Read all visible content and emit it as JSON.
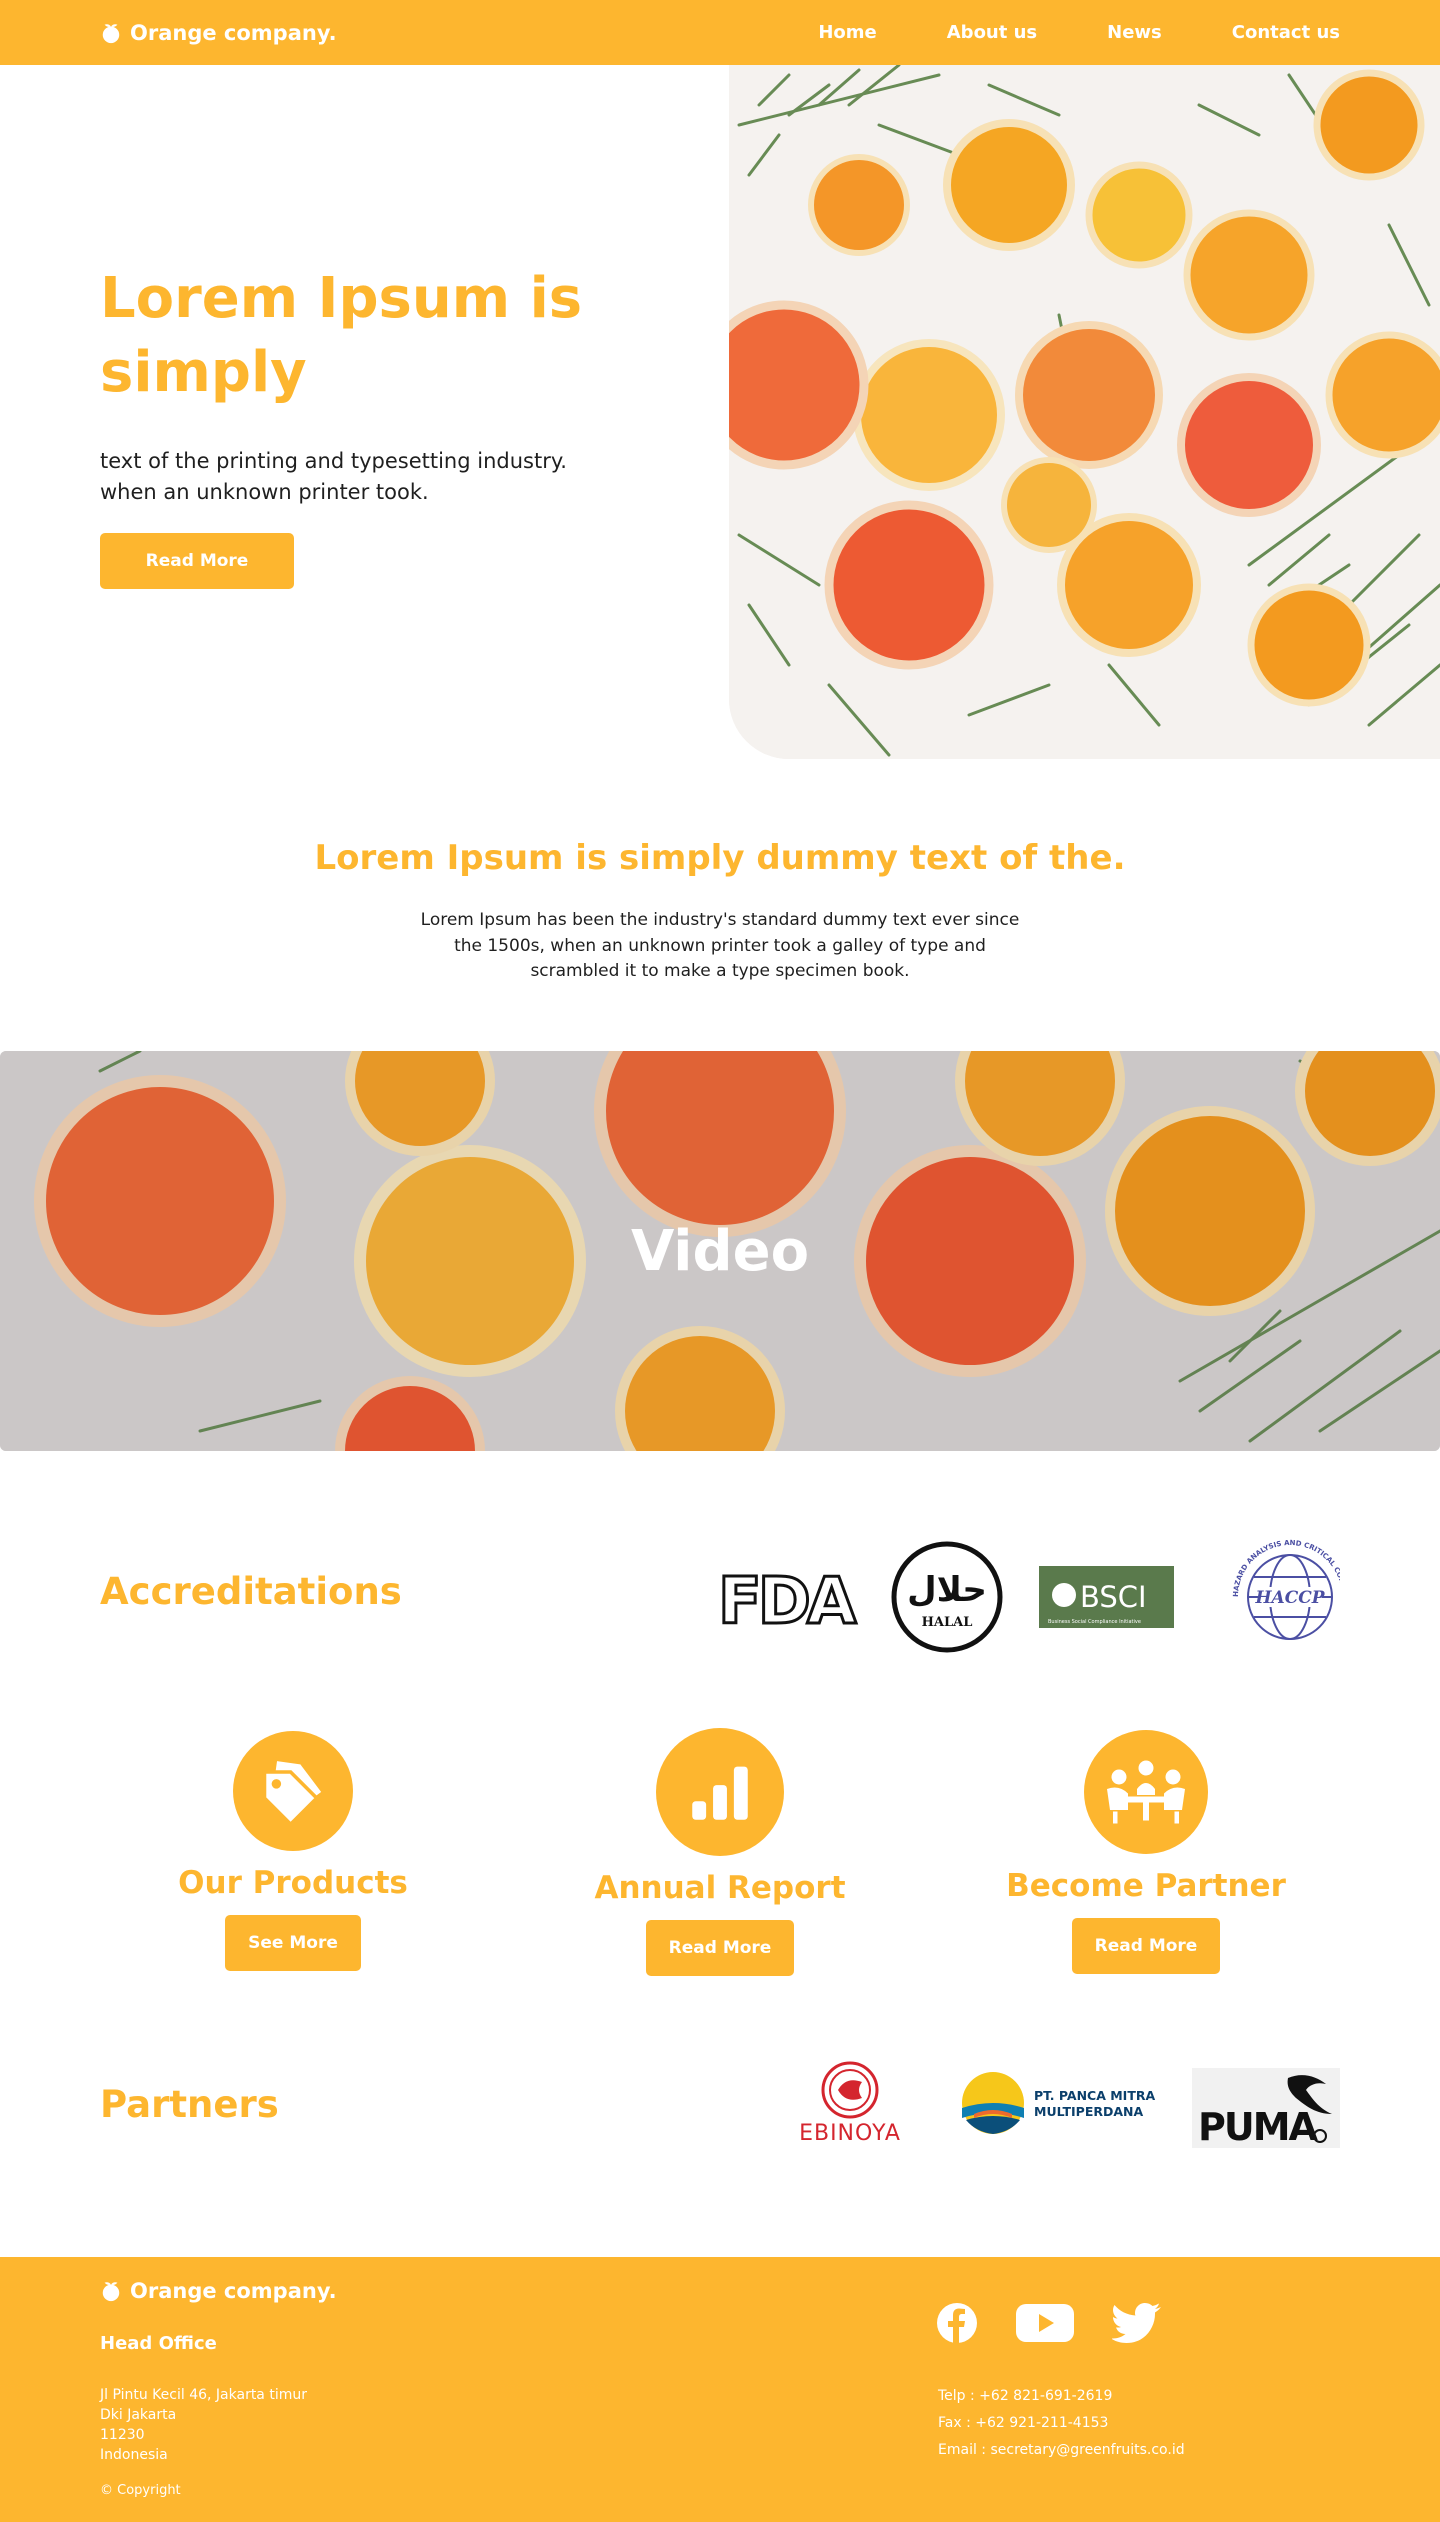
{
  "nav": {
    "brand": "Orange company.",
    "links": [
      "Home",
      "About us",
      "News",
      "Contact us"
    ]
  },
  "hero": {
    "title": "Lorem Ipsum is simply",
    "subtitle_line1": "text of the printing and typesetting industry.",
    "subtitle_line2": "when an unknown printer took.",
    "button": "Read More"
  },
  "intro": {
    "title": "Lorem Ipsum is simply dummy text of the.",
    "text": "Lorem Ipsum has been the industry's standard dummy text ever since the 1500s, when an unknown printer took a galley of type and scrambled it to make a type specimen book."
  },
  "video": {
    "label": "Video"
  },
  "accreditations": {
    "title": "Accreditations",
    "logos": [
      {
        "name": "FDA",
        "text": "FDA"
      },
      {
        "name": "Halal",
        "text": "HALAL",
        "arabic": "حلال"
      },
      {
        "name": "BSCI",
        "text": "BSCI",
        "tagline": "Business Social Compliance Initiative"
      },
      {
        "name": "HACCP",
        "text": "HACCP",
        "ring": "HAZARD ANALYSIS AND CRITICAL CONTROL POINT"
      }
    ]
  },
  "features": [
    {
      "icon": "price-tag-icon",
      "title": "Our Products",
      "button": "See More"
    },
    {
      "icon": "bar-chart-icon",
      "title": "Annual Report",
      "button": "Read More"
    },
    {
      "icon": "meeting-people-icon",
      "title": "Become Partner",
      "button": "Read More"
    }
  ],
  "partners": {
    "title": "Partners",
    "logos": [
      {
        "name": "Ebinoya",
        "text": "EBINOYA"
      },
      {
        "name": "PT Panca Mitra Multiperdana",
        "line1": "PT. PANCA MITRA",
        "line2": "MULTIPERDANA"
      },
      {
        "name": "Puma",
        "text": "PUMA"
      }
    ]
  },
  "footer": {
    "brand": "Orange company.",
    "head_office": "Head Office",
    "address": [
      "Jl Pintu Kecil 46, Jakarta timur",
      "Dki Jakarta",
      "11230",
      "Indonesia"
    ],
    "copyright": "© Copyright",
    "social": [
      "facebook-icon",
      "youtube-icon",
      "twitter-icon"
    ],
    "telp": "Telp : +62 821-691-2619",
    "fax": "Fax : +62 921-211-4153",
    "email": "Email : secretary@greenfruits.co.id"
  },
  "colors": {
    "accent": "#fdb62f",
    "text": "#1f1f1f",
    "white": "#ffffff",
    "bsci_green": "#5a7a4c",
    "haccp_blue": "#4b4fa3",
    "ebinoya_red": "#d4252e"
  }
}
